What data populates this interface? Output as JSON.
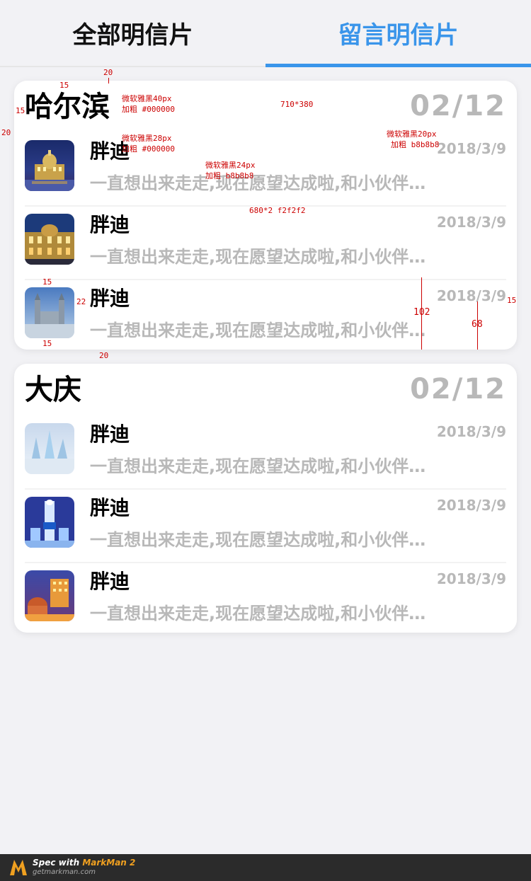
{
  "tabs": [
    {
      "label": "全部明信片",
      "active": false
    },
    {
      "label": "留言明信片",
      "active": true
    }
  ],
  "accent_color": "#3a95ea",
  "cards": [
    {
      "title": "哈尔滨",
      "count": "02/12",
      "rows": [
        {
          "name": "胖迪",
          "date": "2018/3/9",
          "message": "一直想出来走走,现在愿望达成啦,和小伙伴一起",
          "thumb": "harbin-night-palace"
        },
        {
          "name": "胖迪",
          "date": "2018/3/9",
          "message": "一直想出来走走,现在愿望达成啦,和小伙伴一起",
          "thumb": "harbin-street-building"
        },
        {
          "name": "胖迪",
          "date": "2018/3/9",
          "message": "一直想出来走走,现在愿望达成啦,和小伙伴一起",
          "thumb": "harbin-church-day"
        }
      ]
    },
    {
      "title": "大庆",
      "count": "02/12",
      "rows": [
        {
          "name": "胖迪",
          "date": "2018/3/9",
          "message": "一直想出来走走,现在愿望达成啦,和小伙伴一起",
          "thumb": "ice-castle"
        },
        {
          "name": "胖迪",
          "date": "2018/3/9",
          "message": "一直想出来走走,现在愿望达成啦,和小伙伴一起",
          "thumb": "ice-lantern-tower"
        },
        {
          "name": "胖迪",
          "date": "2018/3/9",
          "message": "一直想出来走走,现在愿望达成啦,和小伙伴一起",
          "thumb": "city-night-dome"
        }
      ]
    }
  ],
  "annotations": {
    "title_font": "微软雅黑40px",
    "title_weight": "加粗 #000000",
    "card_size": "710*380",
    "name_font": "微软雅黑28px",
    "name_weight": "加粗 #000000",
    "date_font": "微软雅黑20px",
    "date_weight": "加粗 b8b8b8",
    "msg_font": "微软雅黑24px",
    "msg_weight": "加粗 b8b8b8",
    "divider": "680*2 f2f2f2",
    "gap_20_top": "20",
    "gap_15_a": "15",
    "gap_15_b": "15",
    "gap_20_left": "20",
    "gap_15_thumb": "15",
    "gap_22": "22",
    "gap_15_bottom": "15",
    "gap_20_bottom": "20",
    "gap_15_right": "15",
    "h_102": "102",
    "h_68": "68"
  },
  "footer": {
    "prefix": "Spec with ",
    "brand": "MarkMan 2",
    "url": "getmarkman.com"
  }
}
